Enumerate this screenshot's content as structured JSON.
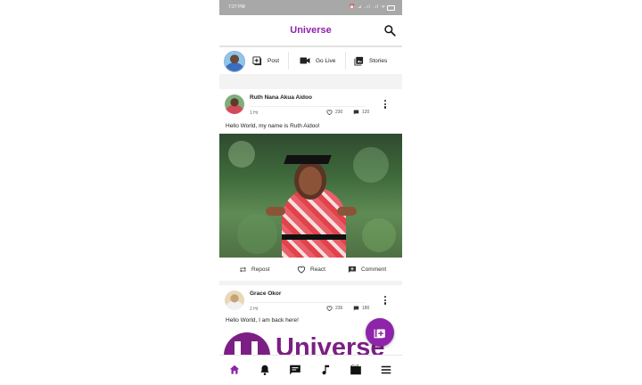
{
  "status_bar": {
    "time": "7:27 PM",
    "indicators": "⏰ ⊿ .ıl .ıl ᯤ"
  },
  "app_bar": {
    "title": "Universe",
    "search_icon": "search-icon"
  },
  "composer": {
    "actions": [
      {
        "label": "Post",
        "icon": "add-photo-icon"
      },
      {
        "label": "Go Live",
        "icon": "video-camera-icon"
      },
      {
        "label": "Stories",
        "icon": "photo-library-icon"
      }
    ]
  },
  "posts": [
    {
      "author": "Ruth Nana Akua Aidoo",
      "time_ago": "1 Hr",
      "likes": "230",
      "comments": "120",
      "text": "Hello World, my name is Ruth Aidoo!",
      "actions": {
        "repost": "Repost",
        "react": "React",
        "comment": "Comment"
      }
    },
    {
      "author": "Grace Okor",
      "time_ago": "2 Hr",
      "likes": "236",
      "comments": "180",
      "text": "Hello World, I am back here!",
      "image_logo_text": "Universe"
    }
  ],
  "bottom_nav": [
    "home-icon",
    "notifications-icon",
    "messages-icon",
    "music-icon",
    "video-icon",
    "menu-icon"
  ],
  "colors": {
    "accent": "#8e24aa",
    "logo": "#7b1f84",
    "status_bar": "#a8a8a8"
  }
}
